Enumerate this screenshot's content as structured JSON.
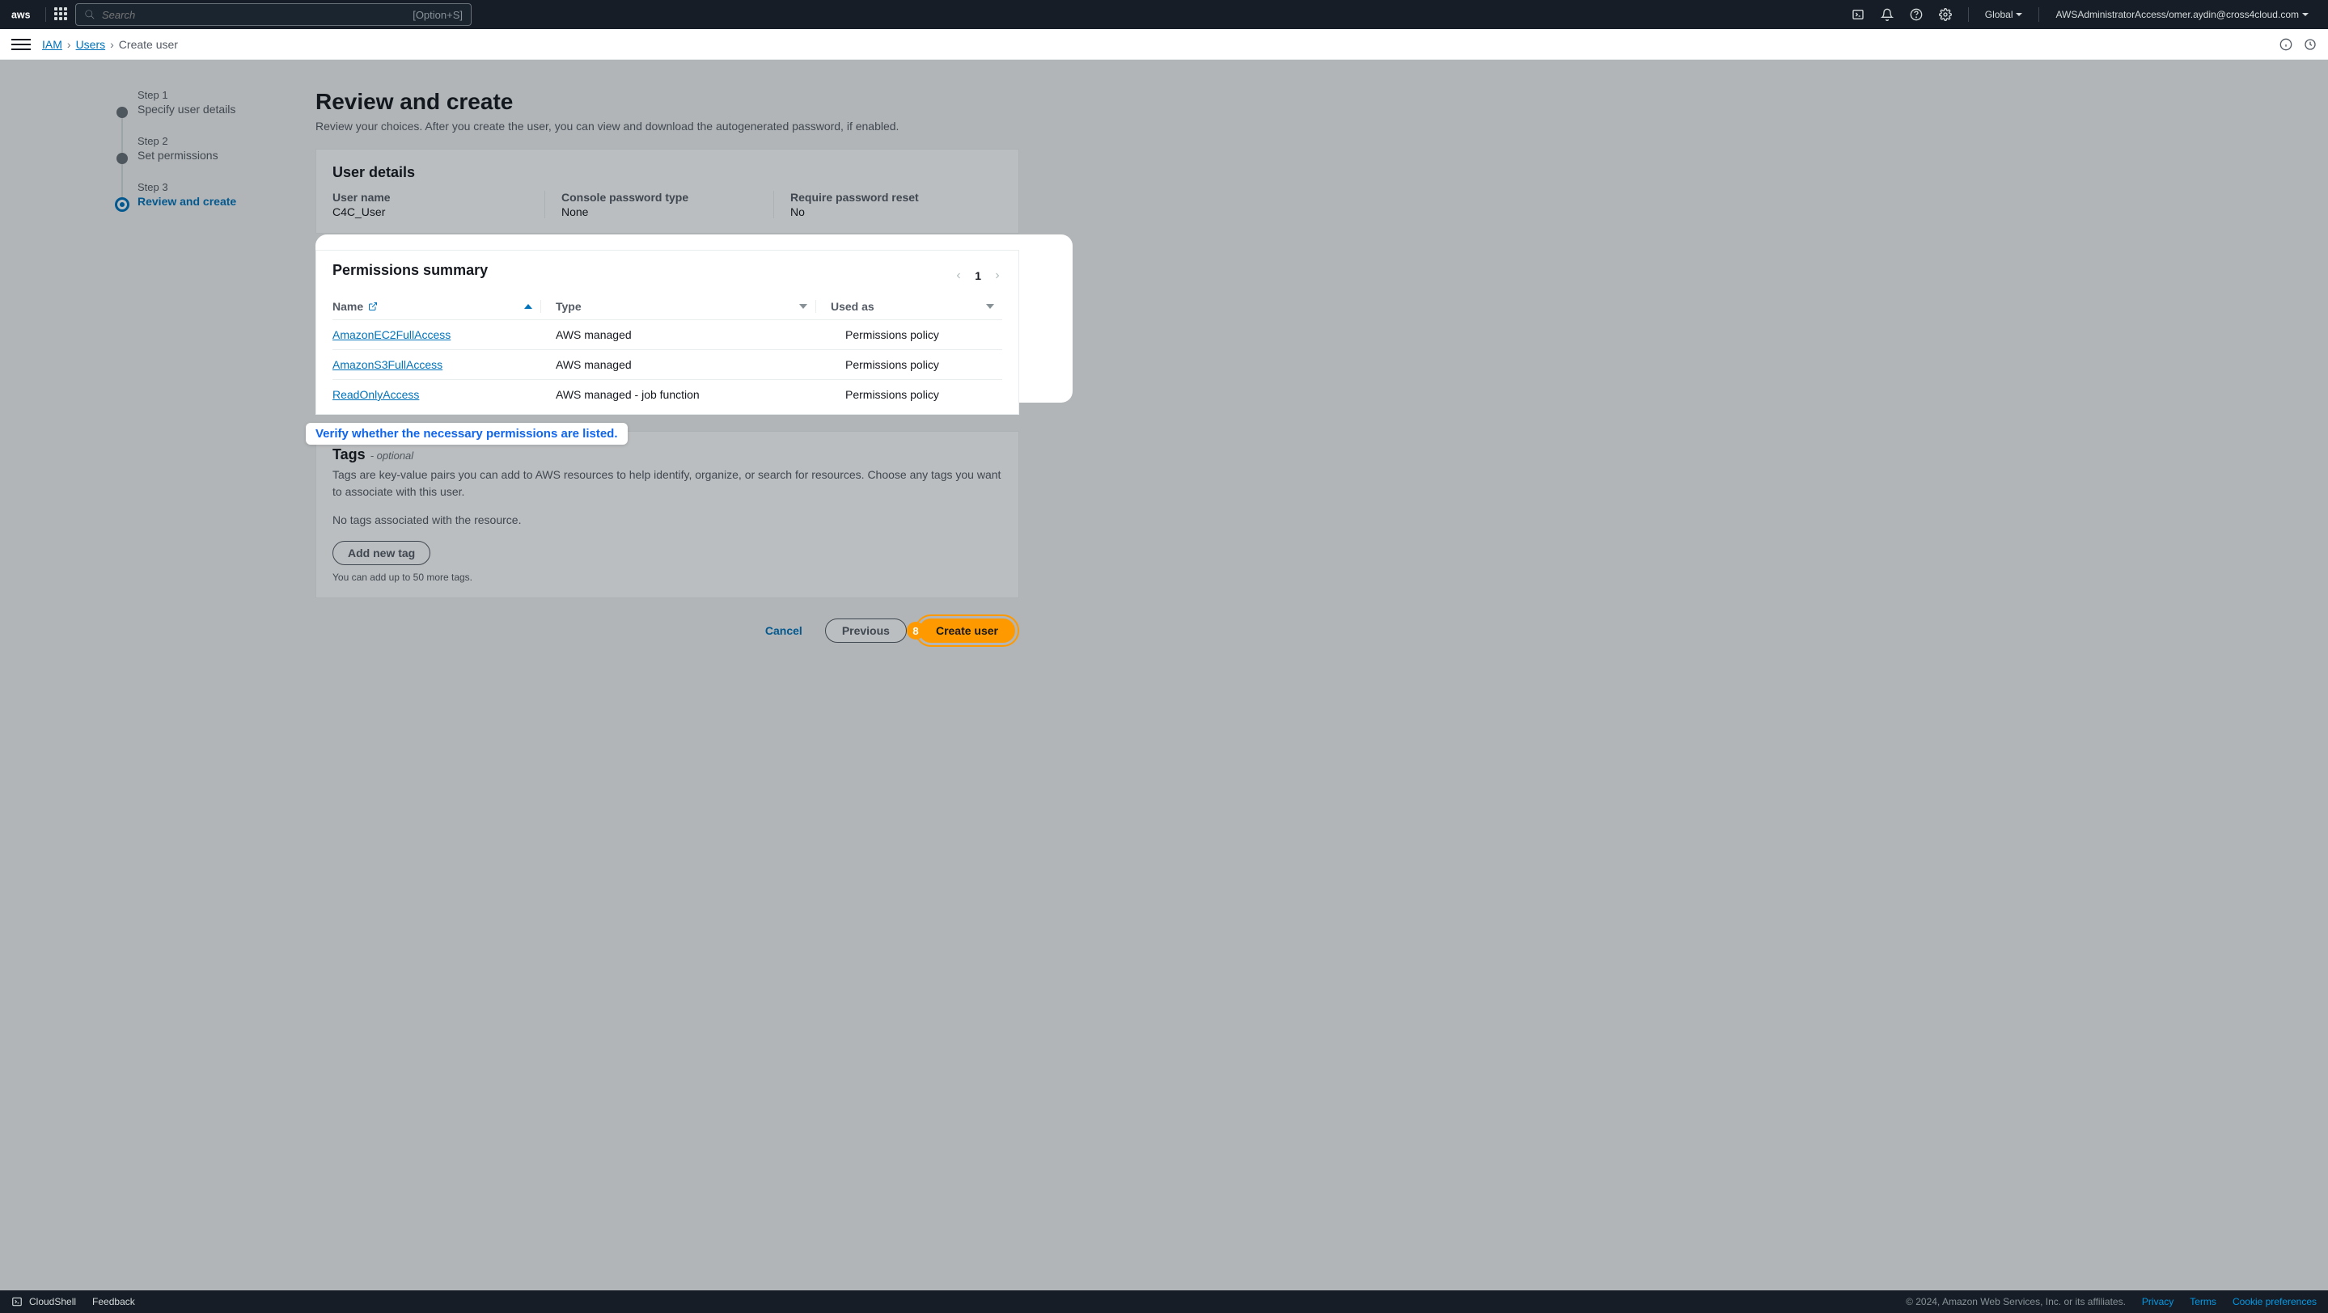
{
  "topnav": {
    "search_placeholder": "Search",
    "search_hint": "[Option+S]",
    "region": "Global",
    "account": "AWSAdministratorAccess/omer.aydin@cross4cloud.com"
  },
  "breadcrumb": {
    "iam": "IAM",
    "users": "Users",
    "current": "Create user"
  },
  "steps": [
    {
      "num": "Step 1",
      "title": "Specify user details"
    },
    {
      "num": "Step 2",
      "title": "Set permissions"
    },
    {
      "num": "Step 3",
      "title": "Review and create"
    }
  ],
  "page": {
    "title": "Review and create",
    "subtitle": "Review your choices. After you create the user, you can view and download the autogenerated password, if enabled."
  },
  "user_details": {
    "heading": "User details",
    "cols": [
      {
        "label": "User name",
        "value": "C4C_User"
      },
      {
        "label": "Console password type",
        "value": "None"
      },
      {
        "label": "Require password reset",
        "value": "No"
      }
    ]
  },
  "permissions": {
    "heading": "Permissions summary",
    "page_num": "1",
    "headers": {
      "name": "Name",
      "type": "Type",
      "used": "Used as"
    },
    "rows": [
      {
        "name": "AmazonEC2FullAccess",
        "type": "AWS managed",
        "used": "Permissions policy"
      },
      {
        "name": "AmazonS3FullAccess",
        "type": "AWS managed",
        "used": "Permissions policy"
      },
      {
        "name": "ReadOnlyAccess",
        "type": "AWS managed - job function",
        "used": "Permissions policy"
      }
    ]
  },
  "callout": "Verify whether the necessary permissions are listed.",
  "tags": {
    "title": "Tags",
    "optional": "- optional",
    "desc": "Tags are key-value pairs you can add to AWS resources to help identify, organize, or search for resources. Choose any tags you want to associate with this user.",
    "none": "No tags associated with the resource.",
    "add": "Add new tag",
    "hint": "You can add up to 50 more tags."
  },
  "actions": {
    "cancel": "Cancel",
    "previous": "Previous",
    "create": "Create user",
    "badge": "8"
  },
  "footer": {
    "cloudshell": "CloudShell",
    "feedback": "Feedback",
    "copyright": "© 2024, Amazon Web Services, Inc. or its affiliates.",
    "privacy": "Privacy",
    "terms": "Terms",
    "cookie": "Cookie preferences"
  }
}
